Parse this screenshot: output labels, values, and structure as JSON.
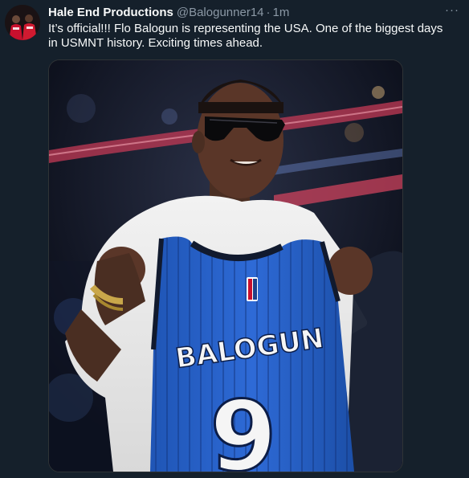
{
  "author": {
    "display_name": "Hale End Productions",
    "handle": "@Balogunner14",
    "separator": "·",
    "time": "1m",
    "avatar_icon": "avatar-photo"
  },
  "more_label": "···",
  "tweet": {
    "text": "It’s official!!! Flo Balogun is representing the USA. One of the biggest days in USMNT history. Exciting times ahead."
  },
  "media": {
    "jersey_name": "BALOGUN",
    "jersey_number": "9",
    "jersey_color": "#2a66c9",
    "icon": "player-jersey-photo"
  },
  "colors": {
    "background": "#15202b",
    "text_primary": "#f7f9f9",
    "text_secondary": "#8b98a5"
  }
}
